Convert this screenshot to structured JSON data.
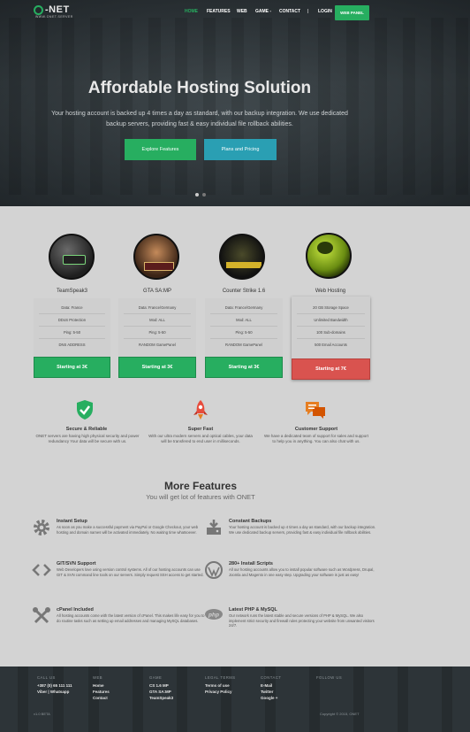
{
  "brand": {
    "name": "-NET",
    "tagline": "WWW.ONET.SERVER"
  },
  "nav": {
    "items": [
      "HOME",
      "FEATURES",
      "WEB",
      "GAME -",
      "CONTACT"
    ],
    "separator": "|",
    "login": "LOGIN",
    "webpanel": "WEB PANEL"
  },
  "hero": {
    "title": "Affordable Hosting Solution",
    "description": "Your hosting account is backed up 4 times a day as standard, with our backup integration. We use dedicated backup servers, providing fast & easy individual file rollback abilities.",
    "btn_explore": "Explore Features",
    "btn_plans": "Plans and Pricing"
  },
  "plans": [
    {
      "name": "TeamSpeak3",
      "icon": "teamspeak-icon",
      "features": [
        "Data: France",
        "DDoS Protection",
        "Ping: 5-50",
        "DNS ADDRESS"
      ],
      "button": "Starting at 3€"
    },
    {
      "name": "GTA SA:MP",
      "icon": "gta-samp-icon",
      "features": [
        "Data: France/Germany",
        "Mod: ALL",
        "Ping: 5-50",
        "RANDOM GamePanel"
      ],
      "button": "Starting at 3€"
    },
    {
      "name": "Counter Strike 1.6",
      "icon": "counter-strike-icon",
      "features": [
        "Data: France/Germany",
        "Mod: ALL",
        "Ping: 5-50",
        "RANDOM GamePanel"
      ],
      "button": "Starting at 3€"
    },
    {
      "name": "Web Hosting",
      "icon": "globe-icon",
      "features": [
        "20 GB Storage Space",
        "Unlimited Bandwidth",
        "100 Sub-domains",
        "500 Email Accounts"
      ],
      "button": "Starting at 7€"
    }
  ],
  "benefits": [
    {
      "title": "Secure & Reliable",
      "desc": "ONET servers are having high physical security and power redundancy Your data will be secure with us.",
      "icon": "shield-check-icon",
      "color": "#27ae60"
    },
    {
      "title": "Super Fast",
      "desc": "With our ultra modern servers and optical cables, your data will be transfered to end user in milliseconds.",
      "icon": "rocket-icon",
      "color": "#e74c3c"
    },
    {
      "title": "Customer Support",
      "desc": "We have a dedicated team of support for sales and support to help you in anything. You can also chat with us.",
      "icon": "chat-icon",
      "color": "#e67e22"
    }
  ],
  "more_features": {
    "title": "More Features",
    "subtitle": "You will get lot of features with ONET",
    "items": [
      {
        "title": "Instant Setup",
        "desc": "As soon as you make a successful payment via PayPal or Google Checkout, your web hosting and domain names will be activated immediately. No waiting time whatsoever.",
        "icon": "gear-icon"
      },
      {
        "title": "Constant Backups",
        "desc": "Your hosting account is backed up 4 times a day as standard, with our backup integration. We use dedicated backup servers, providing fast & easy individual file rollback abilities.",
        "icon": "backup-drive-icon"
      },
      {
        "title": "GIT/SVN Support",
        "desc": "Web Developers love using version control systems. All of our hosting accounts can use GIT & SVN command line tools on our servers. Simply request SSH access to get started.",
        "icon": "code-brackets-icon"
      },
      {
        "title": "280+ Install Scripts",
        "desc": "All our hosting accounts allow you to install popular software such as Wordpress, Drupal, Joomla and Magento in one easy step. Upgrading your software is just as easy!",
        "icon": "wordpress-icon"
      },
      {
        "title": "cPanel Included",
        "desc": "All hosting accounts come with the latest version of cPanel. This makes life easy for you to do routine tasks such as setting up email addresses and managing MySQL databases.",
        "icon": "tools-icon"
      },
      {
        "title": "Latest PHP & MySQL",
        "desc": "Our network runs the latest stable and secure versions of PHP & MySQL. We also implement strict security and firewall rules protecting your website from unwanted visitors 24/7.",
        "icon": "php-icon"
      }
    ]
  },
  "footer": {
    "columns": [
      {
        "head": "CALL US",
        "items": [
          "+387 (0) 65 111 111",
          "Viber | Whatsapp"
        ]
      },
      {
        "head": "WEB",
        "items": [
          "Home",
          "Features",
          "Contact"
        ]
      },
      {
        "head": "GAME",
        "items": [
          "CS 1.6 MP",
          "GTA SA:MP",
          "TeamSpeak3"
        ]
      },
      {
        "head": "LEGAL TERMS",
        "items": [
          "Terms of use",
          "Privacy Policy"
        ]
      },
      {
        "head": "CONTACT",
        "items": [
          "E-Mail",
          "Twitter",
          "Google +"
        ]
      },
      {
        "head": "FOLLOW US",
        "items": []
      }
    ],
    "version": "v1.0 BETA",
    "copyright": "Copyright © 2015, ONET"
  }
}
